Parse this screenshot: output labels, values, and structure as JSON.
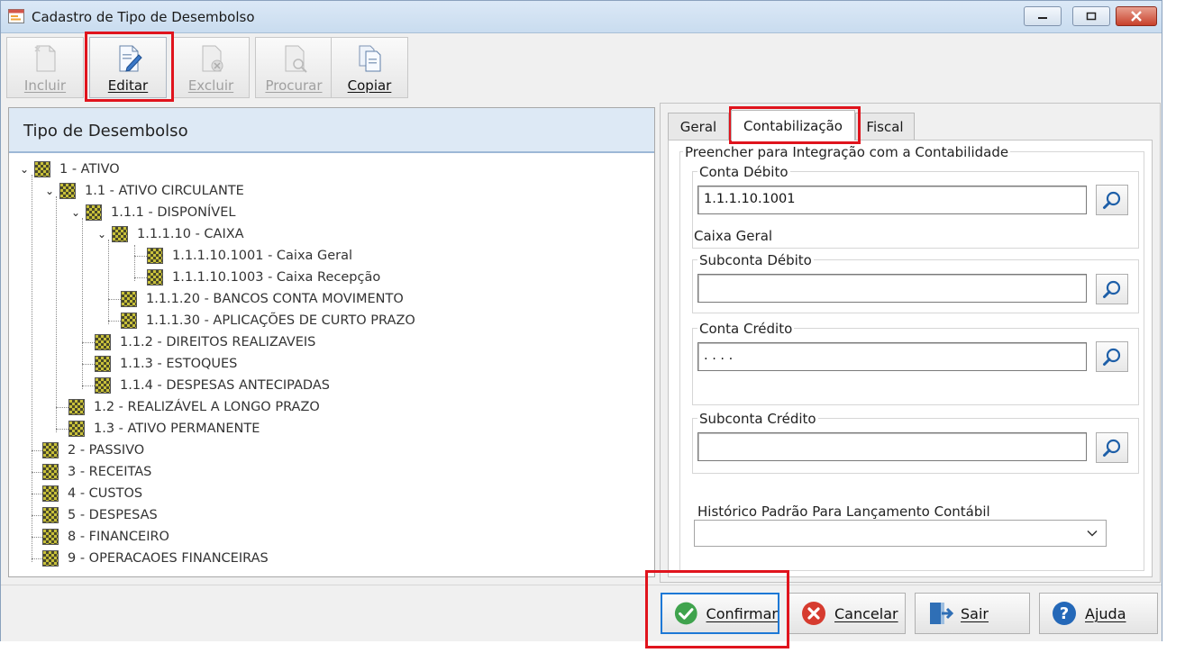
{
  "window": {
    "title": "Cadastro de Tipo de Desembolso"
  },
  "toolbar": {
    "buttons": [
      {
        "label": "Incluir",
        "enabled": false,
        "icon": "new-document-icon"
      },
      {
        "label": "Editar",
        "enabled": true,
        "icon": "edit-document-icon"
      },
      {
        "label": "Excluir",
        "enabled": false,
        "icon": "delete-document-icon"
      },
      {
        "label": "Procurar",
        "enabled": false,
        "icon": "search-document-icon"
      },
      {
        "label": "Copiar",
        "enabled": true,
        "icon": "copy-document-icon"
      }
    ]
  },
  "tree_panel": {
    "header": "Tipo de Desembolso",
    "nodes": [
      "1 - ATIVO",
      "1.1 - ATIVO CIRCULANTE",
      "1.1.1 - DISPONÍVEL",
      "1.1.1.10 - CAIXA",
      "1.1.1.10.1001 - Caixa Geral",
      "1.1.1.10.1003 - Caixa Recepção",
      "1.1.1.20 - BANCOS CONTA MOVIMENTO",
      "1.1.1.30 - APLICAÇÕES DE CURTO PRAZO",
      "1.1.2 - DIREITOS REALIZAVEIS",
      "1.1.3 - ESTOQUES",
      "1.1.4 - DESPESAS ANTECIPADAS",
      "1.2 - REALIZÁVEL A LONGO PRAZO",
      "1.3 - ATIVO PERMANENTE",
      "2 - PASSIVO",
      "3 - RECEITAS",
      "4 - CUSTOS",
      "5 - DESPESAS",
      "8 - FINANCEIRO",
      "9 - OPERACAOES FINANCEIRAS"
    ]
  },
  "tabs": [
    "Geral",
    "Contabilização",
    "Fiscal"
  ],
  "form": {
    "group_title": "Preencher para Integração com a Contabilidade",
    "conta_debito": {
      "label": "Conta Débito",
      "value": "1.1.1.10.1001",
      "description": "Caixa Geral"
    },
    "subconta_debito": {
      "label": "Subconta Débito",
      "value": ""
    },
    "conta_credito": {
      "label": "Conta Crédito",
      "value": " .  .  .  ."
    },
    "subconta_credito": {
      "label": "Subconta Crédito",
      "value": ""
    },
    "historico": {
      "label": "Histórico Padrão Para Lançamento Contábil",
      "value": ""
    }
  },
  "footer": {
    "confirmar": "Confirmar",
    "cancelar": "Cancelar",
    "sair": "Sair",
    "ajuda": "Ajuda"
  },
  "colors": {
    "highlight": "#e0141d",
    "accent": "#1d78d6",
    "header_bg": "#dde9f5"
  }
}
